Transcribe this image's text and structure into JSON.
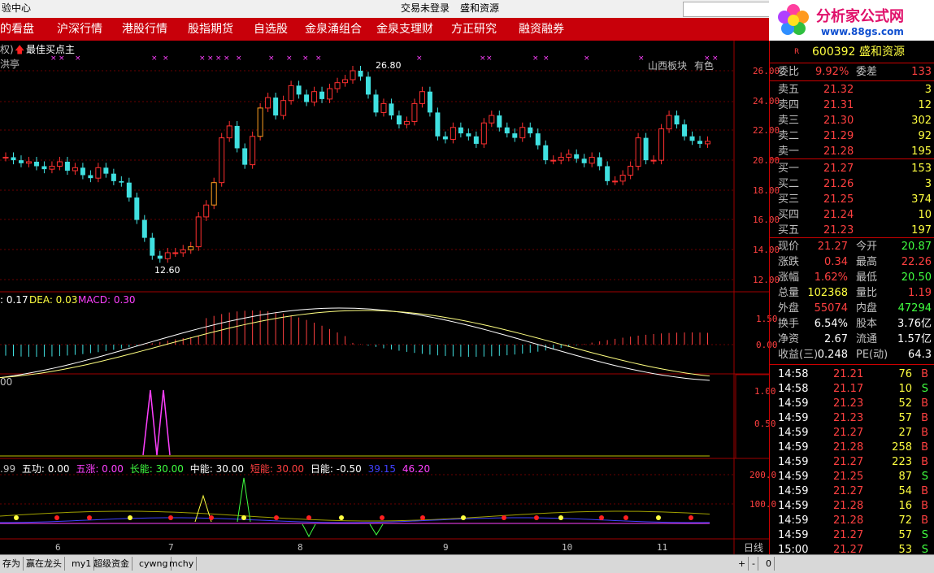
{
  "titlebar": {
    "left_text": "验中心",
    "center_status": "交易未登录",
    "center_stock": "盛和资源"
  },
  "menu": [
    "的看盘",
    "沪深行情",
    "港股行情",
    "股指期货",
    "自选股",
    "金泉涌组合",
    "金泉支理财",
    "方正研究",
    "融资融券"
  ],
  "logo": {
    "brand": "分析家公式网",
    "url": "www.88gs.com"
  },
  "chart_header": {
    "left_tag": "权)",
    "indicator_name": "最佳买点主",
    "sub_label": "洪亭",
    "sector_label": "山西板块",
    "color_label": "有色",
    "peak_label": "26.80",
    "low_label": "12.60"
  },
  "price_axis": [
    "26.00",
    "24.00",
    "22.00",
    "20.00",
    "18.00",
    "16.00",
    "14.00",
    "12.00"
  ],
  "macd": {
    "dif_text": ": 0.17",
    "dea_text": "DEA: 0.03",
    "macd_text": "MACD: 0.30",
    "axis": [
      "1.50",
      "0.00"
    ]
  },
  "panel3": {
    "value_text": "00",
    "axis": [
      "1.00",
      "0.50"
    ]
  },
  "panel4": {
    "items": [
      {
        "text": ".99",
        "color": "#c0c0c0"
      },
      {
        "text": "五功: 0.00",
        "color": "#ffffff"
      },
      {
        "text": "五涨: 0.00",
        "color": "#ff40ff"
      },
      {
        "text": "长能: 30.00",
        "color": "#40ff40"
      },
      {
        "text": "中能: 30.00",
        "color": "#ffffff"
      },
      {
        "text": "短能: 30.00",
        "color": "#ff4040"
      },
      {
        "text": "日能: -0.50",
        "color": "#ffffff"
      },
      {
        "text": "39.15",
        "color": "#4040ff"
      },
      {
        "text": "46.20",
        "color": "#ff40ff"
      }
    ],
    "axis": [
      "200.0",
      "100.0"
    ]
  },
  "x_axis": [
    "6",
    "7",
    "8",
    "9",
    "10",
    "11"
  ],
  "period_label": "日线",
  "quote": {
    "code": "600392",
    "name": "盛和资源",
    "r_mark": "R",
    "weibi_label": "委比",
    "weibi_value": "9.92%",
    "weicha_label": "委差",
    "weicha_value": "133",
    "sell": [
      {
        "label": "卖五",
        "price": "21.32",
        "vol": "3"
      },
      {
        "label": "卖四",
        "price": "21.31",
        "vol": "12"
      },
      {
        "label": "卖三",
        "price": "21.30",
        "vol": "302"
      },
      {
        "label": "卖二",
        "price": "21.29",
        "vol": "92"
      },
      {
        "label": "卖一",
        "price": "21.28",
        "vol": "195"
      }
    ],
    "buy": [
      {
        "label": "买一",
        "price": "21.27",
        "vol": "153"
      },
      {
        "label": "买二",
        "price": "21.26",
        "vol": "3"
      },
      {
        "label": "买三",
        "price": "21.25",
        "vol": "374"
      },
      {
        "label": "买四",
        "price": "21.24",
        "vol": "10"
      },
      {
        "label": "买五",
        "price": "21.23",
        "vol": "197"
      }
    ],
    "stats": [
      {
        "l1": "现价",
        "v1": "21.27",
        "c1": "#ff4040",
        "l2": "今开",
        "v2": "20.87",
        "c2": "#40ff40"
      },
      {
        "l1": "涨跌",
        "v1": "0.34",
        "c1": "#ff4040",
        "l2": "最高",
        "v2": "22.26",
        "c2": "#ff4040"
      },
      {
        "l1": "涨幅",
        "v1": "1.62%",
        "c1": "#ff4040",
        "l2": "最低",
        "v2": "20.50",
        "c2": "#40ff40"
      },
      {
        "l1": "总量",
        "v1": "102368",
        "c1": "#ffff40",
        "l2": "量比",
        "v2": "1.19",
        "c2": "#ff4040"
      },
      {
        "l1": "外盘",
        "v1": "55074",
        "c1": "#ff4040",
        "l2": "内盘",
        "v2": "47294",
        "c2": "#40ff40"
      },
      {
        "l1": "换手",
        "v1": "6.54%",
        "c1": "#ffffff",
        "l2": "股本",
        "v2": "3.76亿",
        "c2": "#ffffff"
      },
      {
        "l1": "净资",
        "v1": "2.67",
        "c1": "#ffffff",
        "l2": "流通",
        "v2": "1.57亿",
        "c2": "#ffffff"
      },
      {
        "l1": "收益(三)",
        "v1": "0.248",
        "c1": "#ffffff",
        "l2": "PE(动)",
        "v2": "64.3",
        "c2": "#ffffff"
      }
    ],
    "ticks": [
      {
        "time": "14:58",
        "price": "21.21",
        "vol": "76",
        "side": "B"
      },
      {
        "time": "14:58",
        "price": "21.17",
        "vol": "10",
        "side": "S"
      },
      {
        "time": "14:59",
        "price": "21.23",
        "vol": "52",
        "side": "B"
      },
      {
        "time": "14:59",
        "price": "21.23",
        "vol": "57",
        "side": "B"
      },
      {
        "time": "14:59",
        "price": "21.27",
        "vol": "27",
        "side": "B"
      },
      {
        "time": "14:59",
        "price": "21.28",
        "vol": "258",
        "side": "B"
      },
      {
        "time": "14:59",
        "price": "21.27",
        "vol": "223",
        "side": "B"
      },
      {
        "time": "14:59",
        "price": "21.25",
        "vol": "87",
        "side": "S"
      },
      {
        "time": "14:59",
        "price": "21.27",
        "vol": "54",
        "side": "B"
      },
      {
        "time": "14:59",
        "price": "21.28",
        "vol": "16",
        "side": "B"
      },
      {
        "time": "14:59",
        "price": "21.28",
        "vol": "72",
        "side": "B"
      },
      {
        "time": "14:59",
        "price": "21.27",
        "vol": "57",
        "side": "S"
      },
      {
        "time": "15:00",
        "price": "21.27",
        "vol": "53",
        "side": "S"
      }
    ]
  },
  "bottom_tabs": [
    "存为",
    "赢在龙头",
    "my1",
    "超级资金",
    "cywng",
    "mchy"
  ],
  "bottom_controls": [
    "+",
    "-",
    "0"
  ]
}
